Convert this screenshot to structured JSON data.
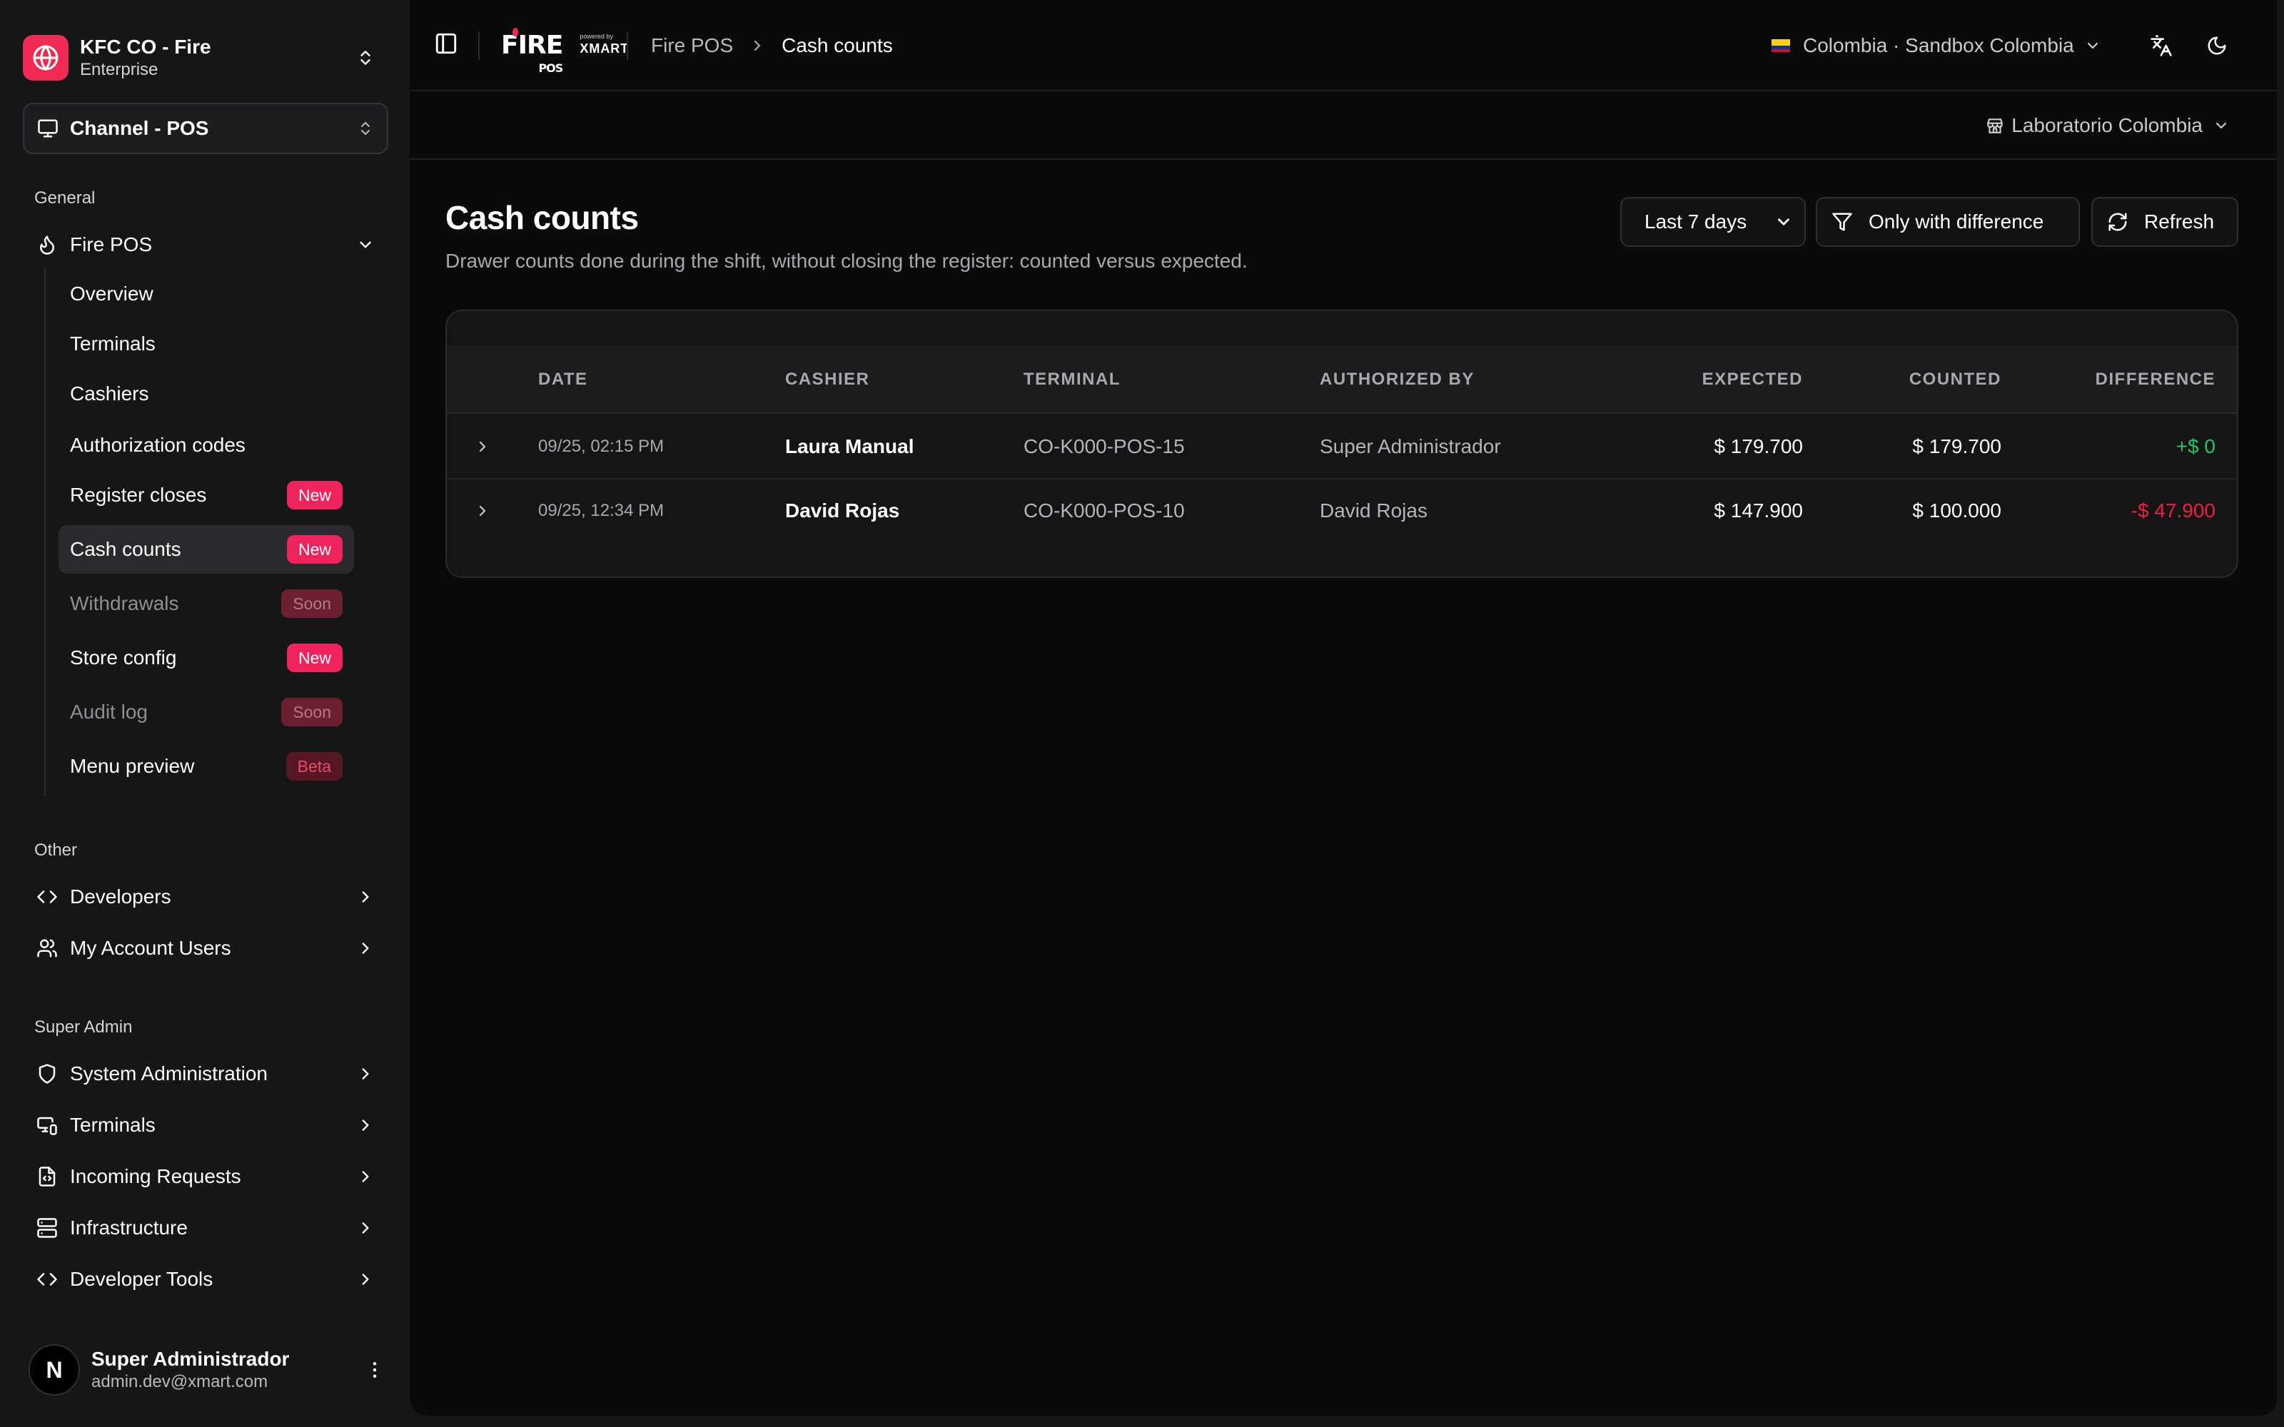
{
  "sidebar": {
    "org": {
      "name": "KFC CO - Fire",
      "plan": "Enterprise"
    },
    "channel": "Channel - POS",
    "general_label": "General",
    "fire_pos_label": "Fire POS",
    "items": [
      {
        "label": "Overview"
      },
      {
        "label": "Terminals"
      },
      {
        "label": "Cashiers"
      },
      {
        "label": "Authorization codes"
      },
      {
        "label": "Register closes",
        "badge": "New"
      },
      {
        "label": "Cash counts",
        "badge": "New"
      },
      {
        "label": "Withdrawals",
        "badge": "Soon"
      },
      {
        "label": "Store config",
        "badge": "New"
      },
      {
        "label": "Audit log",
        "badge": "Soon"
      },
      {
        "label": "Menu preview",
        "badge": "Beta"
      }
    ],
    "other_label": "Other",
    "other_items": [
      {
        "label": "Developers",
        "icon": "code-icon"
      },
      {
        "label": "My Account Users",
        "icon": "users-icon"
      }
    ],
    "super_admin_label": "Super Admin",
    "super_items": [
      {
        "label": "System Administration",
        "icon": "shield-icon"
      },
      {
        "label": "Terminals",
        "icon": "devices-icon"
      },
      {
        "label": "Incoming Requests",
        "icon": "file-code-icon"
      },
      {
        "label": "Infrastructure",
        "icon": "server-icon"
      },
      {
        "label": "Developer Tools",
        "icon": "code-icon"
      }
    ],
    "user": {
      "initial": "N",
      "name": "Super Administrador",
      "email": "admin.dev@xmart.com"
    }
  },
  "topbar": {
    "brand": {
      "fire": "FIRE",
      "pos": "POS",
      "powered": "powered by",
      "xmart": "XMART"
    },
    "breadcrumb_parent": "Fire POS",
    "breadcrumb_current": "Cash counts",
    "country": "Colombia · Sandbox Colombia",
    "store": "Laboratorio Colombia"
  },
  "page": {
    "title": "Cash counts",
    "subtitle": "Drawer counts done during the shift, without closing the register: counted versus expected.",
    "period": "Last 7 days",
    "diff_filter": "Only with difference",
    "refresh": "Refresh"
  },
  "table": {
    "headers": {
      "date": "DATE",
      "cashier": "CASHIER",
      "terminal": "TERMINAL",
      "authorized_by": "AUTHORIZED BY",
      "expected": "EXPECTED",
      "counted": "COUNTED",
      "difference": "DIFFERENCE"
    },
    "rows": [
      {
        "date": "09/25, 02:15 PM",
        "cashier": "Laura Manual",
        "terminal": "CO-K000-POS-15",
        "authorized_by": "Super Administrador",
        "expected": "$ 179.700",
        "counted": "$ 179.700",
        "difference": "+$ 0"
      },
      {
        "date": "09/25, 12:34 PM",
        "cashier": "David Rojas",
        "terminal": "CO-K000-POS-10",
        "authorized_by": "David Rojas",
        "expected": "$ 147.900",
        "counted": "$ 100.000",
        "difference": "-$ 47.900"
      }
    ]
  },
  "colors": {
    "accent": "#ef2a55",
    "positive": "#22c55e",
    "negative": "#ef1f3a",
    "background": "#0a0a0b",
    "sidebar": "#161617"
  }
}
